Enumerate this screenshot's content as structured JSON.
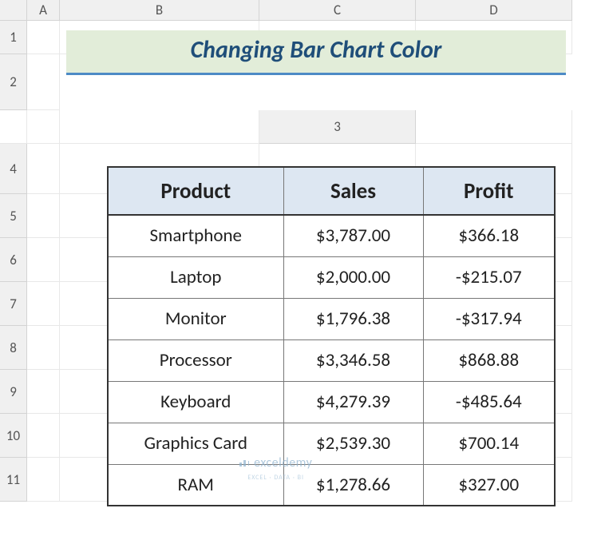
{
  "columns": [
    "A",
    "B",
    "C",
    "D"
  ],
  "rows": [
    "1",
    "2",
    "3",
    "4",
    "5",
    "6",
    "7",
    "8",
    "9",
    "10",
    "11"
  ],
  "title": "Changing Bar Chart Color",
  "headers": {
    "product": "Product",
    "sales": "Sales",
    "profit": "Profit"
  },
  "data": [
    {
      "product": "Smartphone",
      "sales": "$3,787.00",
      "profit": "$366.18"
    },
    {
      "product": "Laptop",
      "sales": "$2,000.00",
      "profit": "-$215.07"
    },
    {
      "product": "Monitor",
      "sales": "$1,796.38",
      "profit": "-$317.94"
    },
    {
      "product": "Processor",
      "sales": "$3,346.58",
      "profit": "$868.88"
    },
    {
      "product": "Keyboard",
      "sales": "$4,279.39",
      "profit": "-$485.64"
    },
    {
      "product": "Graphics Card",
      "sales": "$2,539.30",
      "profit": "$700.14"
    },
    {
      "product": "RAM",
      "sales": "$1,278.66",
      "profit": "$327.00"
    }
  ],
  "watermark": {
    "main": "exceldemy",
    "sub": "EXCEL · DATA · BI"
  }
}
